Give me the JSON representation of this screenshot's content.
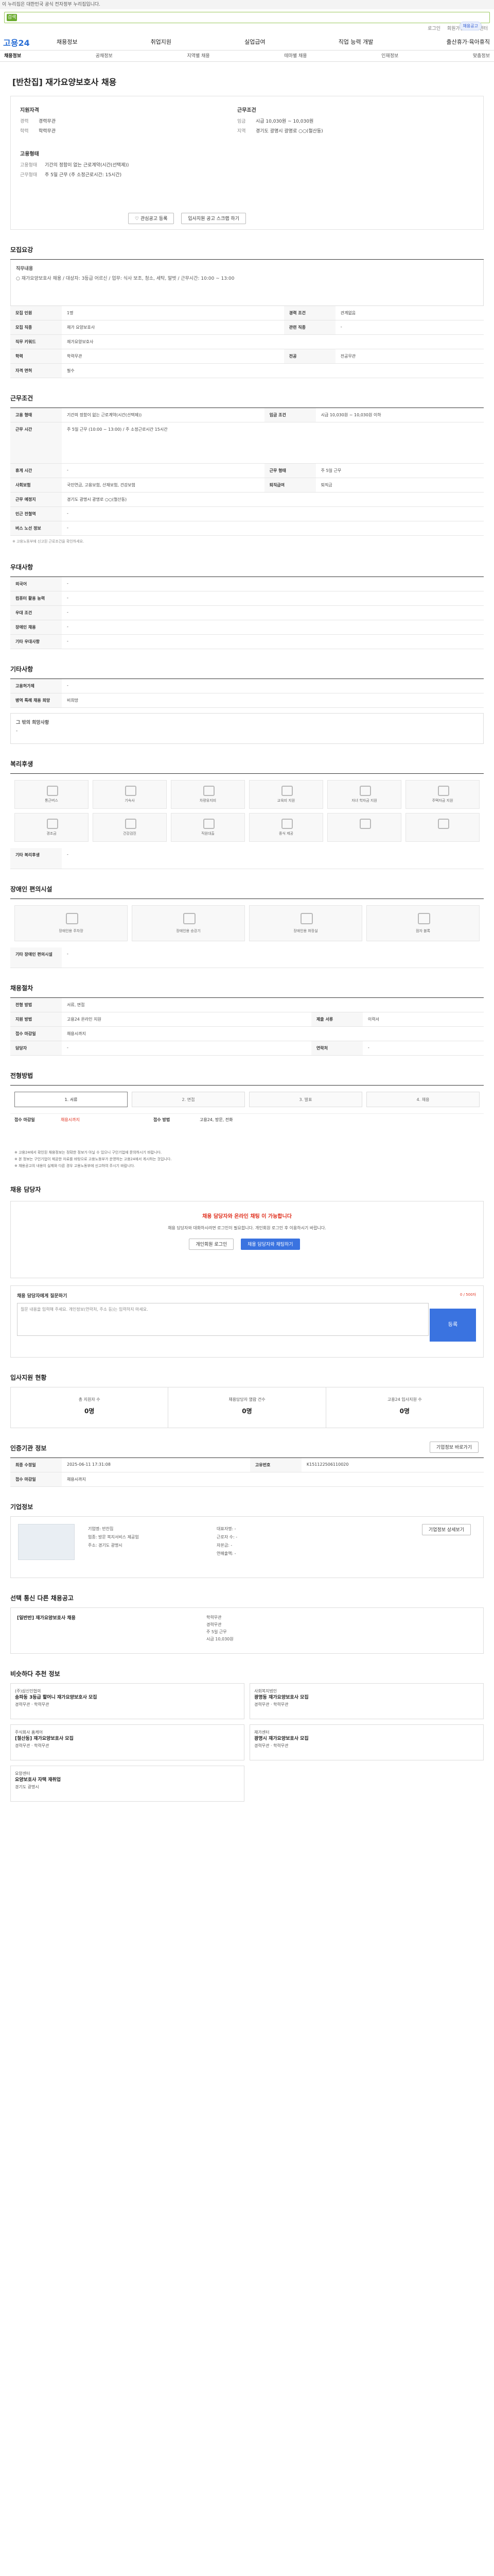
{
  "banner": "이 누리집은 대한민국 공식 전자정부 누리집입니다.",
  "search": {
    "pill": "검색"
  },
  "util": [
    "로그인",
    "회원가입",
    "고객센터"
  ],
  "logo": "고용24",
  "gnb": [
    "채용정보",
    "취업지원",
    "실업급여",
    "직업 능력 개발",
    "출산휴가·육아휴직"
  ],
  "subnav": [
    "채용정보",
    "공채정보",
    "지역별 채용",
    "테마별 채용",
    "인재정보",
    "맞춤정보"
  ],
  "page_title": "[반찬집] 재가요양보호사 채용",
  "badge": "채용공고",
  "summary": {
    "left_title": "지원자격",
    "left_lines": [
      {
        "k": "경력",
        "v": "경력무관"
      },
      {
        "k": "학력",
        "v": "학력무관"
      }
    ],
    "left_title2": "고용형태",
    "left_lines2": [
      {
        "k": "고용형태",
        "v": "기간의 정함이 없는 근로계약(시간(선택제))"
      },
      {
        "k": "근무형태",
        "v": "주 5일 근무 (주 소정근로시간: 15시간)"
      }
    ],
    "right_title": "근무조건",
    "right_lines": [
      {
        "k": "임금",
        "v": "시급 10,030원 ~ 10,030원"
      },
      {
        "k": "지역",
        "v": "경기도 광명시 광명로 ○○(철산동)"
      }
    ],
    "btn_fav": "관심공고 등록",
    "btn_scrap": "입사지원 공고 스크랩 하기"
  },
  "section_recruit": {
    "title": "모집요강",
    "job_desc_title": "직무내용",
    "job_desc": "○ 재가요양보호사 채용 / 대상자: 3등급 어르신 / 업무: 식사 보조, 청소, 세탁, 말벗 / 근무시간: 10:00 ~ 13:00",
    "rows": [
      {
        "k": "모집 인원",
        "v": "1명",
        "k2": "경력 조건",
        "v2": "관계없음"
      },
      {
        "k": "모집 직종",
        "v": "재가 요양보호사",
        "k2": "관련 직종",
        "v2": "-"
      },
      {
        "k": "직무 키워드",
        "v": "재가요양보호사",
        "k2": "",
        "v2": ""
      },
      {
        "k": "학력",
        "v": "학력무관",
        "k2": "전공",
        "v2": "전공무관"
      },
      {
        "k": "자격 면허",
        "v": "필수",
        "k2": "",
        "v2": ""
      }
    ]
  },
  "section_conditions": {
    "title": "근무조건",
    "rows": [
      {
        "k": "고용 형태",
        "v": "기간의 정함이 없는 근로계약(시간(선택제))",
        "k2": "임금 조건",
        "v2": "시급 10,030원 ~ 10,030원 이하"
      },
      {
        "k": "근무 시간",
        "v": "주 5일 근무 (10:00 ~ 13:00) / 주 소정근로시간 15시간",
        "k2": "",
        "v2": ""
      },
      {
        "k": "휴게 시간",
        "v": "-",
        "k2": "근무 형태",
        "v2": "주 5일 근무"
      },
      {
        "k": "사회보험",
        "v": "국민연금, 고용보험, 산재보험, 건강보험",
        "k2": "퇴직급여",
        "v2": "퇴직금"
      },
      {
        "k": "근무 예정지",
        "v": "경기도 광명시 광명로 ○○(철산동)",
        "k2": "",
        "v2": ""
      },
      {
        "k": "인근 전철역",
        "v": "-",
        "k2": "",
        "v2": ""
      },
      {
        "k": "버스 노선 정보",
        "v": "-",
        "k2": "",
        "v2": ""
      }
    ],
    "note": "※ 고용노동부에 신고된 근로조건을 확인하세요."
  },
  "section_pref": {
    "title": "우대사항",
    "rows": [
      {
        "k": "외국어",
        "v": "-"
      },
      {
        "k": "컴퓨터 활용 능력",
        "v": "-"
      },
      {
        "k": "우대 조건",
        "v": "-"
      },
      {
        "k": "장애인 채용",
        "v": "-"
      },
      {
        "k": "기타 우대사항",
        "v": "-"
      }
    ]
  },
  "section_other": {
    "title": "기타사항",
    "rows": [
      {
        "k": "고용허가제",
        "v": "-"
      },
      {
        "k": "병역 특례 채용 희망",
        "v": "비희망"
      }
    ],
    "note_title": "그 밖의 희망사항",
    "note": "-"
  },
  "section_welfare": {
    "title": "복리후생",
    "items": [
      "통근버스",
      "기숙사",
      "차량유지비",
      "교육비 지원",
      "자녀 학자금 지원",
      "주택자금 지원",
      "경조금",
      "건강검진",
      "직원대출",
      "중식 제공",
      "",
      ""
    ],
    "etc_title": "기타 복리후생",
    "etc": "-"
  },
  "section_disabled": {
    "title": "장애인 편의시설",
    "items": [
      "장애인용 주차장",
      "장애인용 승강기",
      "장애인용 화장실",
      "점자 블록"
    ],
    "etc_title": "기타 장애인 편의시설",
    "etc": "-"
  },
  "section_process": {
    "title": "채용절차",
    "rows": [
      {
        "k": "전형 방법",
        "v": "서류, 면접",
        "k2": "",
        "v2": ""
      },
      {
        "k": "지원 방법",
        "v": "고용24 온라인 지원",
        "k2": "제출 서류",
        "v2": "이력서"
      },
      {
        "k": "접수 마감일",
        "v": "채용시까지",
        "k2": "",
        "v2": ""
      },
      {
        "k": "담당자",
        "v": "-",
        "k2": "연락처",
        "v2": "-"
      }
    ]
  },
  "section_steps": {
    "title": "전형방법",
    "steps": [
      "1. 서류",
      "2. 면접",
      "3. 발표",
      "4. 채용"
    ],
    "extra_title": "접수 마감일",
    "extra": "채용시까지",
    "extra2_title": "접수 방법",
    "extra2": "고용24, 방문, 전화",
    "notices": [
      "※ 고용24에서 확인된 채용정보는 정확한 정보가 아닐 수 있으니 구인기업에 문의하시기 바랍니다.",
      "※ 본 정보는 구인기업이 제공한 자료를 바탕으로 고용노동부가 운영하는 고용24에서 게시하는 것입니다.",
      "※ 채용공고의 내용이 실제와 다른 경우 고용노동부에 신고하여 주시기 바랍니다."
    ]
  },
  "section_apply": {
    "title": "채용 담당자",
    "headline": "채용 담당자와 온라인 채팅 이 가능합니다",
    "desc": "채용 담당자와 대화하시려면 로그인이 필요합니다. 개인회원 로그인 후 이용하시기 바랍니다.",
    "btn_login": "개인회원 로그인",
    "btn_chat": "채용 담당자와 채팅하기"
  },
  "section_ask": {
    "title": "채용 담당자에게 질문하기",
    "counter": "0 / 500자",
    "placeholder": "질문 내용을 입력해 주세요. 개인정보(연락처, 주소 등)는 입력하지 마세요.",
    "btn": "등록"
  },
  "section_stats": {
    "title": "입사지원 현황",
    "items": [
      {
        "label": "총 지원자 수",
        "value": "0명"
      },
      {
        "label": "채용담당자 열람 건수",
        "value": "0명"
      },
      {
        "label": "고용24 입사지원 수",
        "value": "0명"
      }
    ]
  },
  "section_info": {
    "title": "인증기관 정보",
    "btn": "기업정보 바로가기",
    "rows": [
      {
        "k": "최종 수정일",
        "v": "2025-06-11 17:31:08",
        "k2": "고유번호",
        "v2": "K151122506110020"
      },
      {
        "k": "접수 마감일",
        "v": "채용시까지",
        "k2": "",
        "v2": ""
      }
    ]
  },
  "section_company": {
    "title": "기업정보",
    "lines": [
      "기업명: 반찬집",
      "업종: 방문 복지서비스 제공업",
      "주소: 경기도 광명시"
    ],
    "lines2": [
      "대표자명: -",
      "근로자 수: -",
      "자본금: -",
      "연매출액: -"
    ],
    "btn": "기업정보 상세보기"
  },
  "section_job": {
    "title": "선택 통신 다른 채용공고",
    "job_title": "[일반반] 재가요양보호사 채용",
    "job_lines": [
      "학력무관",
      "경력무관",
      "주 5일 근무"
    ],
    "job_pay": "시급 10,030원"
  },
  "section_rec": {
    "title": "비슷하다 추천 정보",
    "items": [
      {
        "company": "(주)삼신인협의",
        "title": "송파동 3등급 할머니 재가요양보호사 모집",
        "meta": "경력무관 · 학력무관"
      },
      {
        "company": "사회복지법인",
        "title": "광명동 재가요양보호사 모집",
        "meta": "경력무관 · 학력무관"
      },
      {
        "company": "주식회사 홈케어",
        "title": "[철산동] 재가요양보호사 모집",
        "meta": "경력무관 · 학력무관"
      },
      {
        "company": "재가센터",
        "title": "광명시 재가요양보호사 모집",
        "meta": "경력무관 · 학력무관"
      },
      {
        "company": "요양센터",
        "title": "요양보호사 자택 재취업",
        "meta": "경기도 광명시"
      }
    ]
  }
}
